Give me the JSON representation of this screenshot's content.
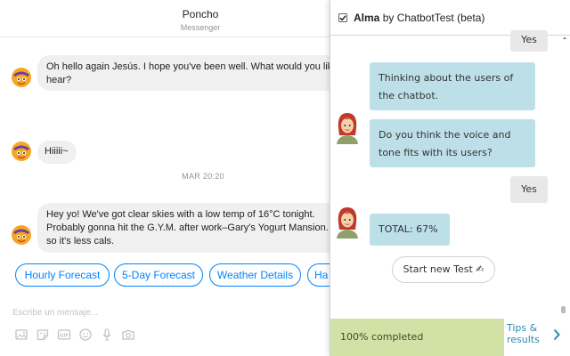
{
  "messenger": {
    "title": "Poncho",
    "subtitle": "Messenger",
    "messages": [
      {
        "lines": [
          "Oh hello again Jesús. I hope you've been well. What would you like t",
          "hear?"
        ]
      },
      {
        "lines": [
          "Hiiiii~"
        ]
      },
      {
        "lines": [
          "Hey yo! We've got clear skies with a low temp of 16°C tonight.",
          "Probably gonna hit the G.Y.M. after work–Gary's Yogurt Mansion. Fro",
          "so it's less cals."
        ]
      }
    ],
    "timestamp": "MAR 20:20",
    "quick_replies": [
      "Hourly Forecast",
      "5-Day Forecast",
      "Weather Details",
      "Ha"
    ],
    "composer_placeholder": "Escribe un mensaje...",
    "tool_icons": [
      "image-icon",
      "sticker-icon",
      "gif-icon",
      "emoji-icon",
      "microphone-icon",
      "camera-icon"
    ]
  },
  "alma": {
    "bot_name": "Alma",
    "by_text": "by ChatbotTest (beta)",
    "conversation": {
      "user_reply_1": "Yes",
      "bot_msg_1": [
        "Thinking about the users of",
        "the chatbot."
      ],
      "bot_msg_2": [
        "Do you think the voice and",
        "tone fits with its users?"
      ],
      "user_reply_2": "Yes",
      "bot_total": "TOTAL: 67%"
    },
    "restart_button": "Start new Test ✍",
    "progress": {
      "value": 100,
      "label": "100% completed"
    },
    "tips_link": [
      "Tips &",
      "results"
    ]
  },
  "colors": {
    "messenger_blue": "#0084ff",
    "bubble_gray": "#f1f0f0",
    "bot_bubble": "#bde0e8",
    "progress_green": "#d2e2a6",
    "tips_blue": "#2f8ab0"
  }
}
